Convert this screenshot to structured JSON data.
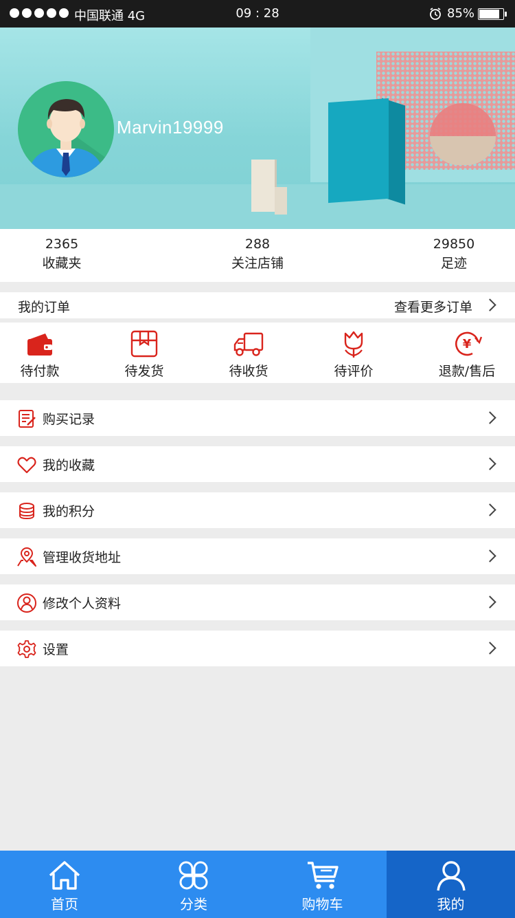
{
  "status_bar": {
    "carrier": "中国联通 4G",
    "time": "09 : 28",
    "battery_percent": "85%",
    "icons": [
      "signal-dots-icon",
      "alarm-icon",
      "battery-icon"
    ]
  },
  "profile": {
    "username": "Marvin19999",
    "avatar_icon": "user-avatar-icon"
  },
  "stats": [
    {
      "value": "2365",
      "label": "收藏夹"
    },
    {
      "value": "288",
      "label": "关注店铺"
    },
    {
      "value": "29850",
      "label": "足迹"
    }
  ],
  "orders": {
    "title": "我的订单",
    "more_label": "查看更多订单",
    "statuses": [
      {
        "label": "待付款",
        "icon": "wallet-icon"
      },
      {
        "label": "待发货",
        "icon": "package-icon"
      },
      {
        "label": "待收货",
        "icon": "truck-icon"
      },
      {
        "label": "待评价",
        "icon": "flower-icon"
      },
      {
        "label": "退款/售后",
        "icon": "yen-refund-icon"
      }
    ]
  },
  "menu": [
    {
      "label": "购买记录",
      "icon": "purchase-record-icon"
    },
    {
      "label": "我的收藏",
      "icon": "heart-icon"
    },
    {
      "label": "我的积分",
      "icon": "coins-icon"
    },
    {
      "label": "管理收货地址",
      "icon": "location-pin-icon"
    },
    {
      "label": "修改个人资料",
      "icon": "profile-edit-icon"
    },
    {
      "label": "设置",
      "icon": "gear-icon"
    }
  ],
  "tabbar": {
    "active_index": 3,
    "tabs": [
      {
        "label": "首页",
        "icon": "home-icon"
      },
      {
        "label": "分类",
        "icon": "category-icon"
      },
      {
        "label": "购物车",
        "icon": "cart-icon"
      },
      {
        "label": "我的",
        "icon": "user-icon"
      }
    ]
  },
  "colors": {
    "accent_red": "#d9241c",
    "tabbar_blue": "#2d8cf0",
    "tabbar_active": "#1565c8",
    "banner_teal": "#86d5d8",
    "page_bg": "#ececec"
  }
}
